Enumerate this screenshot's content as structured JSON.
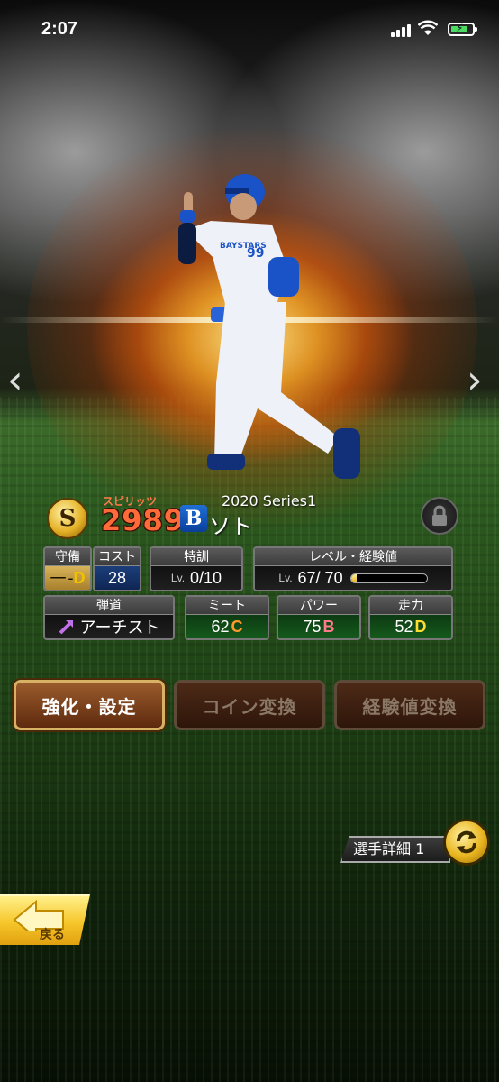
{
  "status_bar": {
    "time": "2:07"
  },
  "card": {
    "spirits_label": "スピリッツ",
    "spirits_value": "2989",
    "team_logo": "B",
    "series": "2020 Series1",
    "player_name_visible": "ソト"
  },
  "stats": {
    "defense": {
      "label": "守備",
      "position": "一",
      "grade": "D"
    },
    "cost": {
      "label": "コスト",
      "value": "28"
    },
    "training": {
      "label": "特訓",
      "lv_prefix": "Lv.",
      "value": "0/10"
    },
    "level": {
      "label": "レベル・経験値",
      "lv_prefix": "Lv.",
      "value": "67/ 70",
      "exp_fill": 0.08
    },
    "trajectory": {
      "label": "弾道",
      "value": "アーチスト"
    },
    "meet": {
      "label": "ミート",
      "value": "62",
      "grade": "C"
    },
    "power": {
      "label": "パワー",
      "value": "75",
      "grade": "B"
    },
    "speed": {
      "label": "走力",
      "value": "52",
      "grade": "D"
    }
  },
  "buttons": {
    "enhance": "強化・設定",
    "coin_convert": "コイン変換",
    "exp_convert": "経験値変換"
  },
  "detail_button": "選手詳細 1",
  "back_button": "戻る",
  "colors": {
    "spirits_text": "#ff6a3a",
    "grade_c": "#ff9a2a",
    "grade_b": "#ff7a8a",
    "grade_d": "#ffdd30",
    "button_border": "#d8b264"
  },
  "icons": [
    "signal-icon",
    "wifi-icon",
    "battery-icon",
    "spirits-coin-icon",
    "team-logo-icon",
    "lock-icon",
    "left-arrow-icon",
    "right-arrow-icon",
    "trajectory-arrow-icon",
    "cycle-icon",
    "back-arrow-icon"
  ]
}
